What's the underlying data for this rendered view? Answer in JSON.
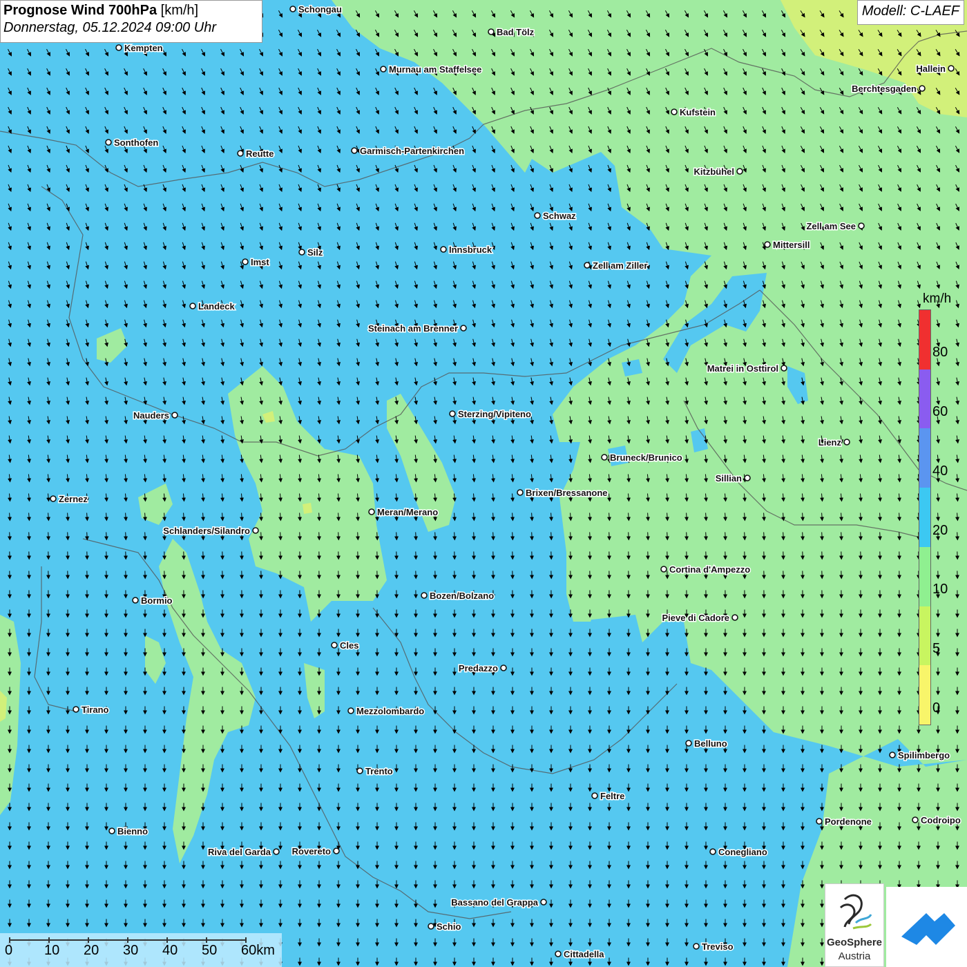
{
  "header": {
    "title_bold": "Prognose Wind 700hPa",
    "title_unit": "[km/h]",
    "datetime": "Donnerstag, 05.12.2024 09:00 Uhr",
    "model": "Modell: C-LAEF"
  },
  "legend": {
    "unit": "km/h",
    "levels": [
      {
        "label": "80",
        "color": "#f03030"
      },
      {
        "label": "60",
        "color": "#8a5cf0"
      },
      {
        "label": "40",
        "color": "#5b95f0"
      },
      {
        "label": "20",
        "color": "#3cc8f2"
      },
      {
        "label": "10",
        "color": "#8ff090"
      },
      {
        "label": "5",
        "color": "#c8f560"
      },
      {
        "label": "0",
        "color": "#f8f56a"
      }
    ]
  },
  "scale": {
    "ticks": [
      "0",
      "10",
      "20",
      "30",
      "40",
      "50",
      "60km"
    ]
  },
  "logos": {
    "geosphere_line1": "GeoSphere",
    "geosphere_line2": "Austria"
  },
  "colors": {
    "sea_blue": "#55c8f0",
    "land_green": "#a0eba0",
    "yellow_green": "#d2f07a",
    "border": "#555555"
  },
  "cities": [
    {
      "name": "Schongau"
    },
    {
      "name": "Bad Tölz"
    },
    {
      "name": "Kempten"
    },
    {
      "name": "Murnau am Staffelsee"
    },
    {
      "name": "Hallein"
    },
    {
      "name": "Berchtesgaden"
    },
    {
      "name": "Kufstein"
    },
    {
      "name": "Sonthofen"
    },
    {
      "name": "Reutte"
    },
    {
      "name": "Garmisch-Partenkirchen"
    },
    {
      "name": "Kitzbühel"
    },
    {
      "name": "Schwaz"
    },
    {
      "name": "Zell am See"
    },
    {
      "name": "Mittersill"
    },
    {
      "name": "Innsbruck"
    },
    {
      "name": "Silz"
    },
    {
      "name": "Imst"
    },
    {
      "name": "Zell am Ziller"
    },
    {
      "name": "Landeck"
    },
    {
      "name": "Steinach am Brenner"
    },
    {
      "name": "Matrei in Osttirol"
    },
    {
      "name": "Nauders"
    },
    {
      "name": "Sterzing/Vipiteno"
    },
    {
      "name": "Lienz"
    },
    {
      "name": "Bruneck/Brunico"
    },
    {
      "name": "Sillian"
    },
    {
      "name": "Zernez"
    },
    {
      "name": "Brixen/Bressanone"
    },
    {
      "name": "Meran/Merano"
    },
    {
      "name": "Schlanders/Silandro"
    },
    {
      "name": "Cortina d'Ampezzo"
    },
    {
      "name": "Bormio"
    },
    {
      "name": "Bozen/Bolzano"
    },
    {
      "name": "Pieve di Cadore"
    },
    {
      "name": "Cles"
    },
    {
      "name": "Predazzo"
    },
    {
      "name": "Tirano"
    },
    {
      "name": "Mezzolombardo"
    },
    {
      "name": "Belluno"
    },
    {
      "name": "Spilimbergo"
    },
    {
      "name": "Trento"
    },
    {
      "name": "Feltre"
    },
    {
      "name": "Bienno"
    },
    {
      "name": "Pordenone"
    },
    {
      "name": "Codroipo"
    },
    {
      "name": "Riva del Garda"
    },
    {
      "name": "Rovereto"
    },
    {
      "name": "Conegliano"
    },
    {
      "name": "Bassano del Grappa"
    },
    {
      "name": "Schio"
    },
    {
      "name": "Treviso"
    },
    {
      "name": "Cittadella"
    }
  ]
}
